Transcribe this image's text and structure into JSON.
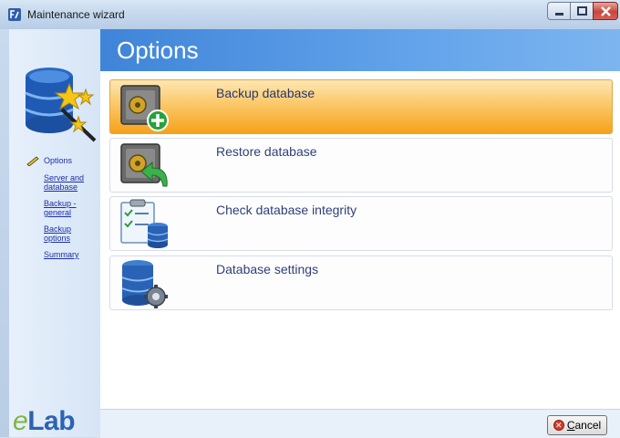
{
  "window": {
    "title": "Maintenance wizard"
  },
  "header": {
    "title": "Options"
  },
  "sidebar": {
    "current": "Options",
    "items": [
      {
        "label": "Server and database"
      },
      {
        "label": "Backup - general"
      },
      {
        "label": "Backup options"
      },
      {
        "label": "Summary"
      }
    ]
  },
  "options": [
    {
      "label": "Backup database",
      "icon": "safe-add-icon",
      "selected": true
    },
    {
      "label": "Restore database",
      "icon": "safe-restore-icon",
      "selected": false
    },
    {
      "label": "Check database integrity",
      "icon": "checklist-database-icon",
      "selected": false
    },
    {
      "label": "Database settings",
      "icon": "database-gear-icon",
      "selected": false
    }
  ],
  "footer": {
    "logo": "eLab",
    "cancel_label_prefix": "",
    "cancel_mnemonic": "C",
    "cancel_label_rest": "ancel"
  },
  "colors": {
    "header_blue": "#3f84d8",
    "selected_orange": "#f5a21a",
    "link_blue": "#1d2fa8"
  }
}
